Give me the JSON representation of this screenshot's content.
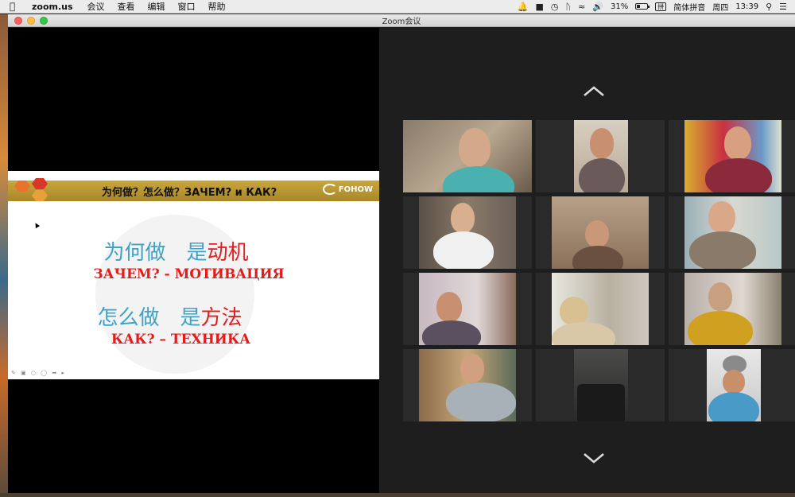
{
  "menubar": {
    "app_name": "zoom.us",
    "menus": [
      "会议",
      "查看",
      "编辑",
      "窗口",
      "帮助"
    ],
    "battery_percent": "31%",
    "battery_level": 0.31,
    "input_method_badge": "拼",
    "input_method": "简体拼音",
    "weekday": "周四",
    "time": "13:39",
    "icons": [
      "apple-icon",
      "notification-bell-icon",
      "video-camera-icon",
      "time-machine-icon",
      "bluetooth-icon",
      "wifi-icon",
      "volume-icon",
      "battery-icon",
      "search-icon",
      "control-center-icon"
    ]
  },
  "window": {
    "title": "Zoom会议"
  },
  "slide": {
    "header": "为何做？怎么做？ЗАЧЕМ? и КАК?",
    "logo": "FOHOW",
    "line1_blue": "为何做　是",
    "line1_red": "动机",
    "line2": "ЗАЧЕМ? - МОТИВАЦИЯ",
    "line3_blue": "怎么做　是",
    "line3_red": "方法",
    "line4": "КАК? – ТЕХНИКА",
    "colors": {
      "header_gold": "#c9a73b",
      "chinese_blue": "#3fa3c9",
      "red": "#e02020"
    }
  },
  "gallery": {
    "page_up_icon": "chevron-up-icon",
    "page_down_icon": "chevron-down-icon",
    "tile_count": 12
  }
}
